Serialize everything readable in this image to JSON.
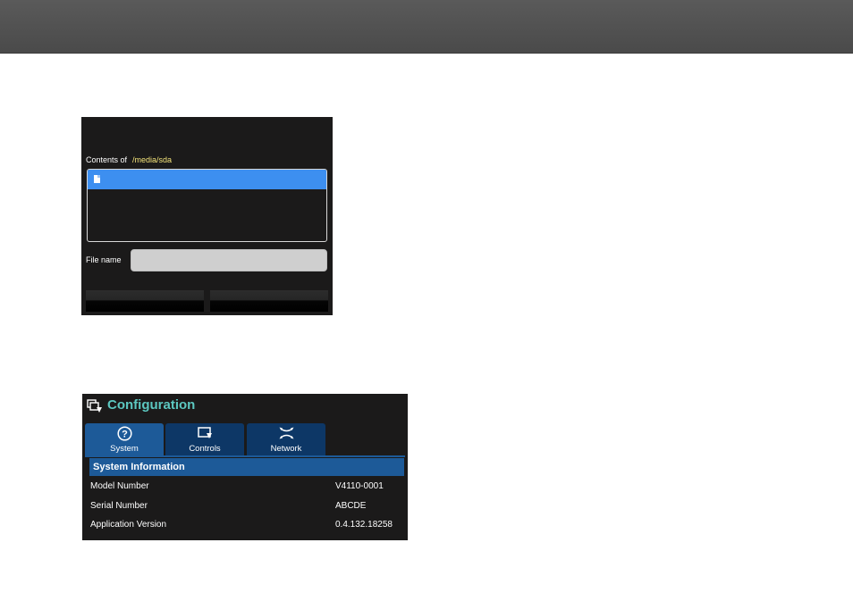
{
  "file_dialog": {
    "contents_label": "Contents of",
    "path": "/media/sda",
    "file_items": [
      ""
    ],
    "filename_label": "File name",
    "filename_value": "",
    "left_button_label": "",
    "right_button_label": ""
  },
  "config": {
    "title": "Configuration",
    "tabs": [
      {
        "label": "System",
        "icon": "question-icon",
        "active": true
      },
      {
        "label": "Controls",
        "icon": "controls-icon",
        "active": false
      },
      {
        "label": "Network",
        "icon": "network-icon",
        "active": false
      }
    ],
    "section_title": "System Information",
    "rows": [
      {
        "label": "Model Number",
        "value": "V4110-0001"
      },
      {
        "label": "Serial Number",
        "value": "ABCDE"
      },
      {
        "label": "Application Version",
        "value": "0.4.132.18258"
      }
    ]
  },
  "colors": {
    "title_teal": "#5cc7c0",
    "path_yellow": "#f3e37a",
    "selection_blue": "#3d8ff0",
    "tab_active": "#1d5a98",
    "tab_inactive": "#0d3766"
  }
}
